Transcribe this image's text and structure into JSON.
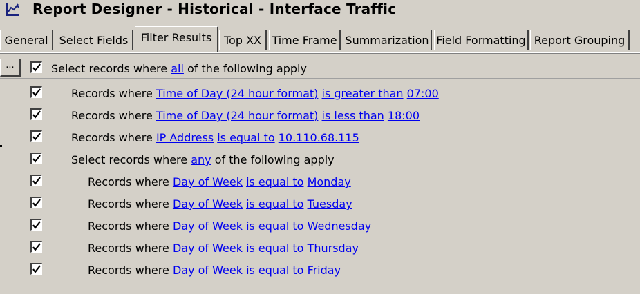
{
  "window": {
    "title": "Report Designer - Historical - Interface Traffic"
  },
  "tabs": [
    {
      "label": "General"
    },
    {
      "label": "Select Fields"
    },
    {
      "label": "Filter Results",
      "active": true
    },
    {
      "label": "Top XX"
    },
    {
      "label": "Time Frame"
    },
    {
      "label": "Summarization"
    },
    {
      "label": "Field Formatting"
    },
    {
      "label": "Report Grouping"
    }
  ],
  "toolbar": {
    "more_label": "..."
  },
  "filters": {
    "top_group": {
      "checked": true,
      "prefix": "Select records where",
      "mode": "all",
      "suffix": "of the following apply"
    },
    "rules": [
      {
        "checked": true,
        "prefix": "Records where",
        "field": "Time of Day (24 hour format)",
        "operator": "is greater than",
        "value": "07:00"
      },
      {
        "checked": true,
        "prefix": "Records where",
        "field": "Time of Day (24 hour format)",
        "operator": "is less than",
        "value": "18:00"
      },
      {
        "checked": true,
        "prefix": "Records where",
        "field": "IP Address",
        "operator": "is equal to",
        "value": "10.110.68.115"
      }
    ],
    "sub_group": {
      "checked": true,
      "prefix": "Select records where",
      "mode": "any",
      "suffix": "of the following apply",
      "rules": [
        {
          "checked": true,
          "prefix": "Records where",
          "field": "Day of Week",
          "operator": "is equal to",
          "value": "Monday"
        },
        {
          "checked": true,
          "prefix": "Records where",
          "field": "Day of Week",
          "operator": "is equal to",
          "value": "Tuesday"
        },
        {
          "checked": true,
          "prefix": "Records where",
          "field": "Day of Week",
          "operator": "is equal to",
          "value": "Wednesday"
        },
        {
          "checked": true,
          "prefix": "Records where",
          "field": "Day of Week",
          "operator": "is equal to",
          "value": "Thursday"
        },
        {
          "checked": true,
          "prefix": "Records where",
          "field": "Day of Week",
          "operator": "is equal to",
          "value": "Friday"
        }
      ]
    }
  },
  "colors": {
    "background": "#d4d0c8",
    "link": "#0000ee"
  },
  "icons": {
    "app": "report-designer-icon",
    "check": "checkmark-icon"
  }
}
